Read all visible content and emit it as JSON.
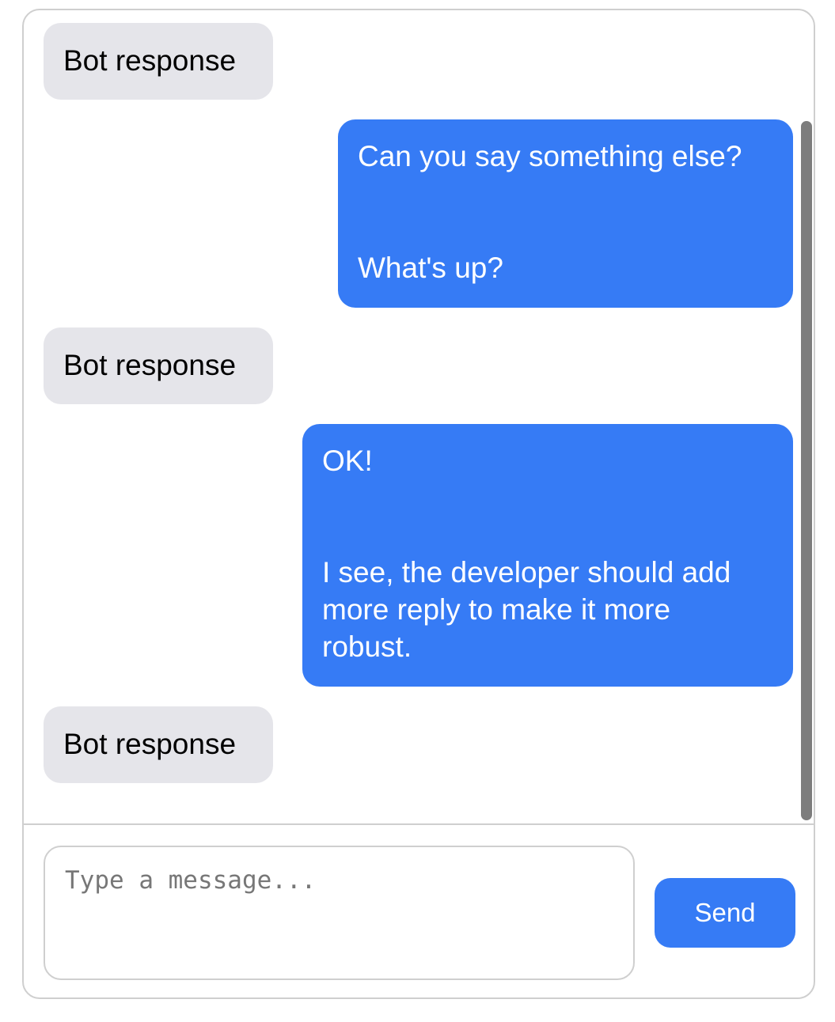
{
  "messages": [
    {
      "sender": "bot",
      "text": "Bot response"
    },
    {
      "sender": "user",
      "text": "Can you say something else?\n\n\nWhat's up?"
    },
    {
      "sender": "bot",
      "text": "Bot response"
    },
    {
      "sender": "user",
      "text": "OK!\n\n\nI see, the developer should add\nmore reply to make it more\nrobust."
    },
    {
      "sender": "bot",
      "text": "Bot response"
    }
  ],
  "composer": {
    "placeholder": "Type a message...",
    "value": "",
    "send_label": "Send"
  },
  "colors": {
    "user_bubble": "#367bf5",
    "bot_bubble": "#e5e5ea",
    "send_button": "#367bf5",
    "border": "#cfcfcf",
    "scrollbar": "#7d7d7d"
  }
}
